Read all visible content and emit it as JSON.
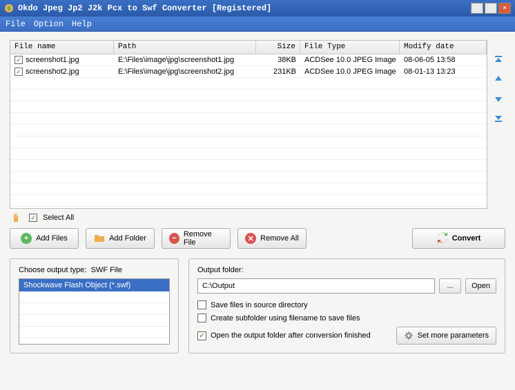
{
  "title": "Okdo Jpeg Jp2 J2k Pcx to Swf Converter [Registered]",
  "menu": {
    "file": "File",
    "option": "Option",
    "help": "Help"
  },
  "columns": {
    "name": "File name",
    "path": "Path",
    "size": "Size",
    "type": "File Type",
    "date": "Modify date"
  },
  "files": [
    {
      "checked": true,
      "name": "screenshot1.jpg",
      "path": "E:\\Files\\image\\jpg\\screenshot1.jpg",
      "size": "38KB",
      "type": "ACDSee 10.0 JPEG Image",
      "date": "08-06-05 13:58"
    },
    {
      "checked": true,
      "name": "screenshot2.jpg",
      "path": "E:\\Files\\image\\jpg\\screenshot2.jpg",
      "size": "231KB",
      "type": "ACDSee 10.0 JPEG Image",
      "date": "08-01-13 13:23"
    }
  ],
  "select_all": {
    "checked": true,
    "label": "Select All"
  },
  "buttons": {
    "add_files": "Add Files",
    "add_folder": "Add Folder",
    "remove_file": "Remove File",
    "remove_all": "Remove All",
    "convert": "Convert"
  },
  "output_type": {
    "label_prefix": "Choose output type:",
    "label_value": "SWF File",
    "selected": "Shockwave Flash Object (*.swf)"
  },
  "output_folder": {
    "label": "Output folder:",
    "value": "C:\\Output",
    "browse": "...",
    "open": "Open"
  },
  "options": {
    "save_source": {
      "checked": false,
      "label": "Save files in source directory"
    },
    "create_sub": {
      "checked": false,
      "label": "Create subfolder using filename to save files"
    },
    "open_after": {
      "checked": true,
      "label": "Open the output folder after conversion finished"
    }
  },
  "more_params": "Set more parameters"
}
